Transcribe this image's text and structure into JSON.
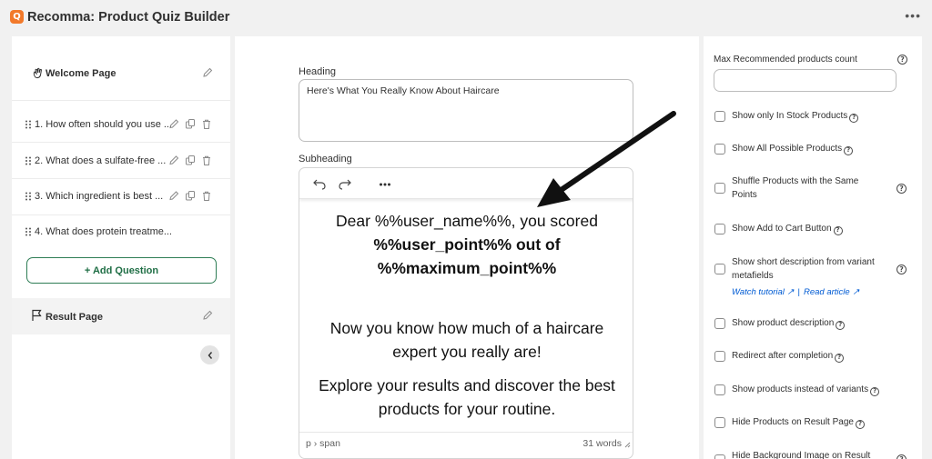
{
  "app": {
    "title": "Recomma: Product Quiz Builder",
    "logo_letter": "Q",
    "more_label": "•••"
  },
  "sidebar": {
    "welcome_label": "Welcome Page",
    "questions": [
      {
        "label": "1. How often should you use ..."
      },
      {
        "label": "2. What does a sulfate-free ..."
      },
      {
        "label": "3. Which ingredient is best ..."
      },
      {
        "label": "4. What does protein treatme..."
      }
    ],
    "add_question_label": "+ Add Question",
    "result_label": "Result Page"
  },
  "editor": {
    "heading_label": "Heading",
    "heading_value": "Here's What You Really Know About Haircare",
    "subheading_label": "Subheading",
    "lines": {
      "l1": "Dear %%user_name%%, you scored",
      "l2": "%%user_point%% out of",
      "l3": "%%maximum_point%%",
      "l4": "Now you know how much of a haircare",
      "l5": "expert you really are!",
      "l6": "Explore your results and discover the best",
      "l7": "products for your routine."
    },
    "status_path": "p › span",
    "word_count": "31 words"
  },
  "settings": {
    "max_count_label": "Max Recommended products count",
    "max_count_value": "",
    "options": [
      {
        "label": "Show only In Stock Products"
      },
      {
        "label": "Show All Possible Products"
      },
      {
        "label": "Shuffle Products with the Same",
        "label2": "Points"
      },
      {
        "label": "Show Add to Cart Button"
      },
      {
        "label": "Show short description from variant",
        "label2": "metafields"
      },
      {
        "label": "Show product description"
      },
      {
        "label": "Redirect after completion"
      },
      {
        "label": "Show products instead of variants"
      },
      {
        "label": "Hide Products on Result Page"
      },
      {
        "label": "Hide Background Image on Result"
      }
    ],
    "watch_tutorial": "Watch tutorial ↗",
    "read_article": "Read article ↗",
    "link_sep": "|"
  },
  "colors": {
    "accent_green": "#2e7d55",
    "logo_orange": "#f2792a",
    "link_blue": "#005bd3"
  }
}
